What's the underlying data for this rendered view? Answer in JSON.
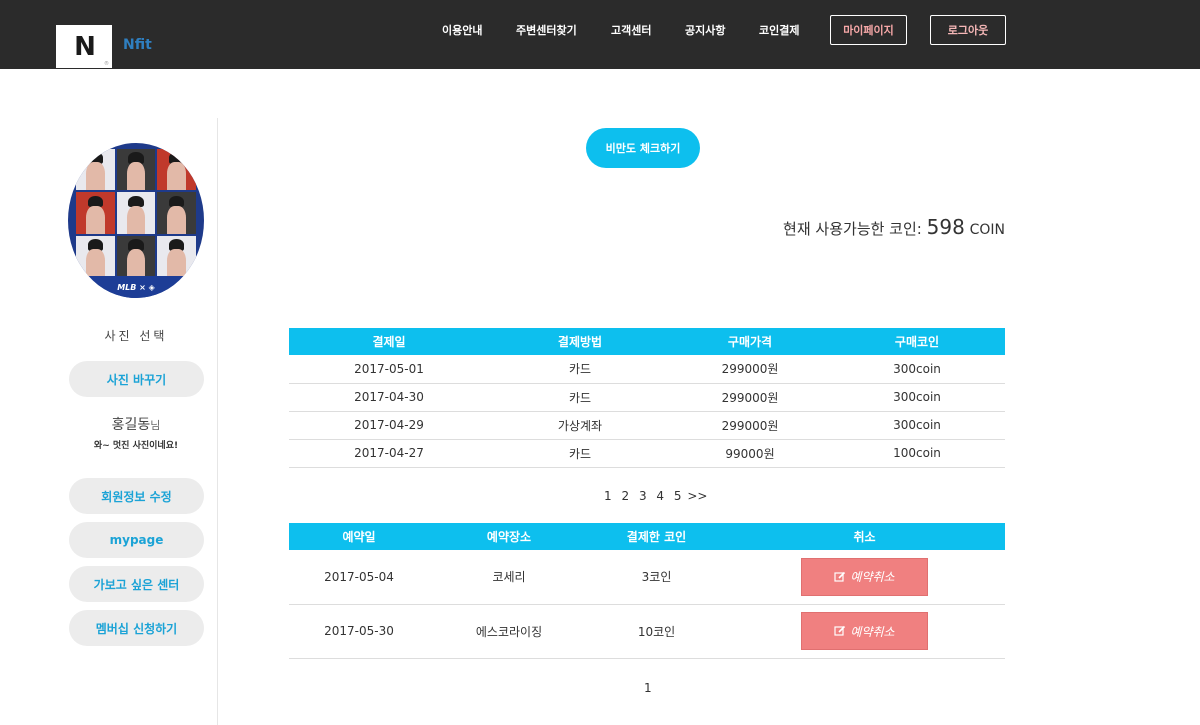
{
  "header": {
    "brand": "Nfit",
    "logo_mark": "N",
    "nav": [
      "이용안내",
      "주변센터찾기",
      "고객센터",
      "공지사항",
      "코인결제"
    ],
    "mypage_label": "마이페이지",
    "logout_label": "로그아웃"
  },
  "sidebar": {
    "photo_banner": "MLB × ◈",
    "photo_select": "사진 선택",
    "change_photo": "사진 바꾸기",
    "user_name": "홍길동",
    "user_suffix": "님",
    "user_message": "와~ 멋진 사진이네요!",
    "menu": [
      "회원정보 수정",
      "mypage",
      "가보고 싶은 센터",
      "멤버십 신청하기"
    ]
  },
  "main": {
    "bmi_button": "비만도 체크하기",
    "coin_label": "현재 사용가능한 코인:",
    "coin_value": "598",
    "coin_unit": "COIN",
    "payments": {
      "headers": [
        "결제일",
        "결제방법",
        "구매가격",
        "구매코인"
      ],
      "rows": [
        [
          "2017-05-01",
          "카드",
          "299000원",
          "300coin"
        ],
        [
          "2017-04-30",
          "카드",
          "299000원",
          "300coin"
        ],
        [
          "2017-04-29",
          "가상계좌",
          "299000원",
          "300coin"
        ],
        [
          "2017-04-27",
          "카드",
          "99000원",
          "100coin"
        ]
      ],
      "pages": [
        "1",
        "2",
        "3",
        "4",
        "5"
      ],
      "next": ">>"
    },
    "reservations": {
      "headers": [
        "예약일",
        "예약장소",
        "결제한 코인",
        "취소"
      ],
      "rows": [
        [
          "2017-05-04",
          "코세리",
          "3코인"
        ],
        [
          "2017-05-30",
          "에스코라이징",
          "10코인"
        ]
      ],
      "cancel_label": "예약취소",
      "cancel_icon": "edit-icon",
      "pages": [
        "1"
      ]
    }
  },
  "colors": {
    "header_bg": "#2b2b2b",
    "accent": "#0dbfee",
    "cancel": "#f08080",
    "sidebar_btn_bg": "#ececec",
    "sidebar_btn_text": "#1ba3d6"
  }
}
